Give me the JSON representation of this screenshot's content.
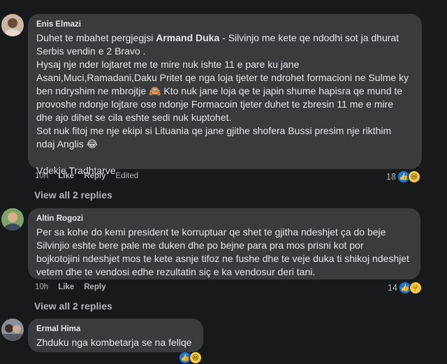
{
  "comments": [
    {
      "author": "Enis Elmazi",
      "lines_before_mention": "Duhet te mbahet pergjegjsi ",
      "mention": "Armand Duka",
      "line1_after": " - Silvinjo me kete qe ndodhi sot ja dhurat",
      "body_rest": "Serbis vendin e 2 Bravo .\nHysaj nje nder lojtaret me te mire nuk ishte 11 e pare ku jane\nAsani,Muci,Ramadani,Daku Pritet qe nga loja tjeter te ndrohet formacioni ne Sulme ky\nben ndryshim ne mbrojtje 🙈 Kto nuk jane loja qe te japin shume hapisra qe mund te\nprovoshe ndonje lojtare ose ndonje Formacoin tjeter duhet te zbresin 11 me e mire\ndhe ajo dihet se cila eshte sedi nuk kuptohet.\nSot nuk fitoj me nje ekipi si Lituania qe jane gjithe shofera Bussi presim nje rikthim\nndaj Anglis 😂\n\nVdekje Tradhtarve",
      "time": "10h",
      "like_label": "Like",
      "reply_label": "Reply",
      "edited_label": "Edited",
      "reaction_count": "18",
      "view_replies": "View all 2 replies"
    },
    {
      "author": "Altin Rogozi",
      "body": "Per sa kohe do kemi president te korruptuar qe shet te gjitha ndeshjet ça do beje\nSilvinjio eshte bere pale me duken dhe po bejne para pra mos prisni kot por\nbojkotojini ndeshjet mos te kete asnje tifoz ne fushe dhe te veje duka ti shikoj ndeshjet\nvetem dhe te vendosi edhe rezultatin siç e ka vendosur deri tani.",
      "time": "10h",
      "like_label": "Like",
      "reply_label": "Reply",
      "reaction_count": "14",
      "view_replies": "View all 2 replies"
    },
    {
      "author": "Ermal Hima",
      "body": "Zhduku nga kombetarja se na fellqe"
    }
  ],
  "icons": {
    "like": "thumbs-up-icon",
    "haha": "haha-emoji-icon",
    "care": "care-emoji-icon"
  },
  "colors": {
    "background": "#18191a",
    "bubble": "#3a3b3c",
    "like_blue": "#1b74e4",
    "secondary_text": "#b0b3b8"
  }
}
